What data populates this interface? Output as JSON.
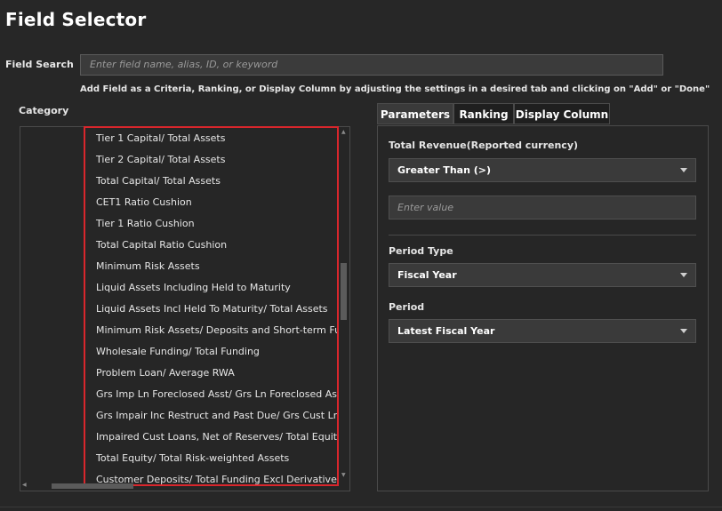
{
  "window": {
    "title": "Field Selector"
  },
  "search": {
    "label": "Field Search",
    "placeholder": "Enter field name, alias, ID, or keyword",
    "hint": "Add Field as a Criteria, Ranking, or Display Column by adjusting the settings in a desired tab and clicking on \"Add\" or \"Done\""
  },
  "category": {
    "label": "Category",
    "items": [
      "Tier 1 Capital/ Total Assets",
      "Tier 2 Capital/ Total Assets",
      "Total Capital/ Total Assets",
      "CET1 Ratio Cushion",
      "Tier 1 Ratio Cushion",
      "Total Capital Ratio Cushion",
      "Minimum Risk Assets",
      "Liquid Assets Including Held to Maturity",
      "Liquid Assets Incl Held To Maturity/ Total Assets",
      "Minimum Risk Assets/ Deposits and Short-term Fund",
      "Wholesale Funding/ Total Funding",
      "Problem Loan/ Average RWA",
      "Grs Imp Ln Foreclosed Asst/ Grs Ln Foreclosed Asst",
      "Grs Impair Inc Restruct and Past Due/ Grs Cust Lns",
      "Impaired Cust Loans, Net of Reserves/ Total Equity",
      "Total Equity/ Total Risk-weighted Assets",
      "Customer Deposits/ Total Funding Excl Derivatives"
    ]
  },
  "tabs": {
    "parameters": "Parameters",
    "ranking": "Ranking",
    "display_column": "Display Column"
  },
  "parameters": {
    "field_label": "Total Revenue(Reported currency)",
    "operator": "Greater Than (>)",
    "value_placeholder": "Enter value",
    "period_type_label": "Period Type",
    "period_type_value": "Fiscal Year",
    "period_label": "Period",
    "period_value": "Latest Fiscal Year"
  },
  "colors": {
    "highlight": "#d9262c"
  }
}
